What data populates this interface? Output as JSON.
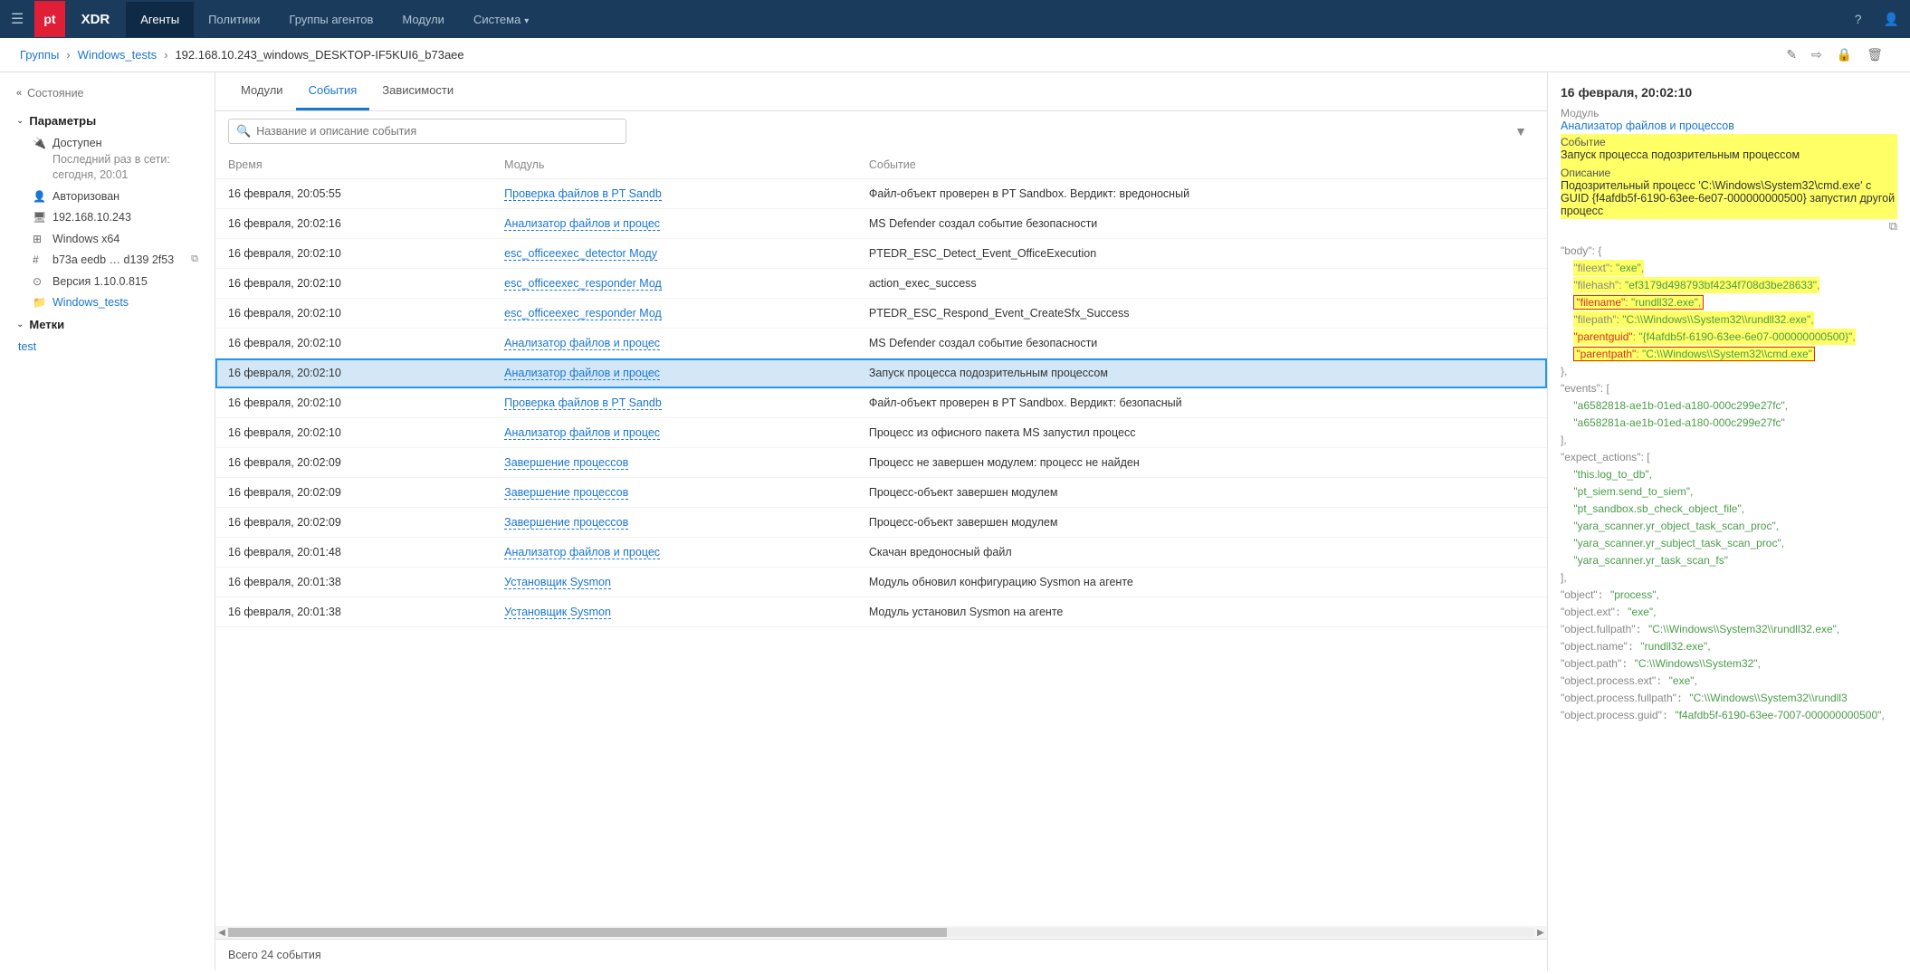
{
  "topbar": {
    "logo": "pt",
    "product": "XDR",
    "nav": [
      "Агенты",
      "Политики",
      "Группы агентов",
      "Модули",
      "Система"
    ],
    "nav_with_chevron": [
      false,
      false,
      false,
      false,
      true
    ]
  },
  "breadcrumb": {
    "groups": "Группы",
    "windows_tests": "Windows_tests",
    "current": "192.168.10.243_windows_DESKTOP-IF5KUI6_b73aee"
  },
  "sidebar": {
    "state_label": "Состояние",
    "params_label": "Параметры",
    "available": "Доступен",
    "last_seen_label": "Последний раз в сети: сегодня, 20:01",
    "authorized": "Авторизован",
    "ip": "192.168.10.243",
    "os": "Windows x64",
    "guid": "b73a eedb … d139 2f53",
    "version": "Версия 1.10.0.815",
    "group_link": "Windows_tests",
    "tags_label": "Метки",
    "tag": "test"
  },
  "tabs": {
    "modules": "Модули",
    "events": "События",
    "deps": "Зависимости"
  },
  "search": {
    "placeholder": "Название и описание события"
  },
  "table": {
    "cols": {
      "time": "Время",
      "module": "Модуль",
      "event": "Событие"
    },
    "rows": [
      {
        "time": "16 февраля, 20:05:55",
        "module": "Проверка файлов в PT Sandb",
        "event": "Файл-объект проверен в PT Sandbox. Вердикт: вредоносный"
      },
      {
        "time": "16 февраля, 20:02:16",
        "module": "Анализатор файлов и процес",
        "event": "MS Defender создал событие безопасности"
      },
      {
        "time": "16 февраля, 20:02:10",
        "module": "esc_officeexec_detector Моду",
        "event": "PTEDR_ESC_Detect_Event_OfficeExecution"
      },
      {
        "time": "16 февраля, 20:02:10",
        "module": "esc_officeexec_responder Мод",
        "event": "action_exec_success"
      },
      {
        "time": "16 февраля, 20:02:10",
        "module": "esc_officeexec_responder Мод",
        "event": "PTEDR_ESC_Respond_Event_CreateSfx_Success"
      },
      {
        "time": "16 февраля, 20:02:10",
        "module": "Анализатор файлов и процес",
        "event": "MS Defender создал событие безопасности"
      },
      {
        "time": "16 февраля, 20:02:10",
        "module": "Анализатор файлов и процес",
        "event": "Запуск процесса подозрительным процессом",
        "sel": true
      },
      {
        "time": "16 февраля, 20:02:10",
        "module": "Проверка файлов в PT Sandb",
        "event": "Файл-объект проверен в PT Sandbox. Вердикт: безопасный"
      },
      {
        "time": "16 февраля, 20:02:10",
        "module": "Анализатор файлов и процес",
        "event": "Процесс из офисного пакета MS запустил процесс"
      },
      {
        "time": "16 февраля, 20:02:09",
        "module": "Завершение процессов",
        "event": "Процесс не завершен модулем: процесс не найден"
      },
      {
        "time": "16 февраля, 20:02:09",
        "module": "Завершение процессов",
        "event": "Процесс-объект завершен модулем"
      },
      {
        "time": "16 февраля, 20:02:09",
        "module": "Завершение процессов",
        "event": "Процесс-объект завершен модулем"
      },
      {
        "time": "16 февраля, 20:01:48",
        "module": "Анализатор файлов и процес",
        "event": "Скачан вредоносный файл"
      },
      {
        "time": "16 февраля, 20:01:38",
        "module": "Установщик Sysmon",
        "event": "Модуль обновил конфигурацию Sysmon на агенте"
      },
      {
        "time": "16 февраля, 20:01:38",
        "module": "Установщик Sysmon",
        "event": "Модуль установил Sysmon на агенте"
      }
    ],
    "footer": "Всего 24 события"
  },
  "detail": {
    "title": "16 февраля, 20:02:10",
    "module_label": "Модуль",
    "module_link": "Анализатор файлов и процессов",
    "event_label": "Событие",
    "event_value": "Запуск процесса подозрительным процессом",
    "desc_label": "Описание",
    "desc_value": "Подозрительный процесс 'C:\\Windows\\System32\\cmd.exe' с GUID {f4afdb5f-6190-63ee-6e07-000000000500} запустил другой процесс",
    "json": {
      "body_open": "\"body\": {",
      "fileext": {
        "k": "\"fileext\"",
        "v": "\"exe\""
      },
      "filehash": {
        "k": "\"filehash\"",
        "v": "\"ef3179d498793bf4234f708d3be28633\""
      },
      "filename": {
        "k": "\"filename\"",
        "v": "\"rundll32.exe\""
      },
      "filepath": {
        "k": "\"filepath\"",
        "v": "\"C:\\\\Windows\\\\System32\\\\rundll32.exe\""
      },
      "parentguid": {
        "k": "\"parentguid\"",
        "v": "\"{f4afdb5f-6190-63ee-6e07-000000000500}\""
      },
      "parentpath": {
        "k": "\"parentpath\"",
        "v": "\"C:\\\\Windows\\\\System32\\\\cmd.exe\""
      },
      "body_close": "},",
      "events_open": "\"events\": [",
      "event1": "\"a6582818-ae1b-01ed-a180-000c299e27fc\",",
      "event2": "\"a658281a-ae1b-01ed-a180-000c299e27fc\"",
      "events_close": "],",
      "expect_open": "\"expect_actions\": [",
      "ea1": "\"this.log_to_db\",",
      "ea2": "\"pt_siem.send_to_siem\",",
      "ea3": "\"pt_sandbox.sb_check_object_file\",",
      "ea4": "\"yara_scanner.yr_object_task_scan_proc\",",
      "ea5": "\"yara_scanner.yr_subject_task_scan_proc\",",
      "ea6": "\"yara_scanner.yr_task_scan_fs\"",
      "expect_close": "],",
      "object": {
        "k": "\"object\"",
        "v": "\"process\","
      },
      "object_ext": {
        "k": "\"object.ext\"",
        "v": "\"exe\","
      },
      "object_fullpath": {
        "k": "\"object.fullpath\"",
        "v": "\"C:\\\\Windows\\\\System32\\\\rundll32.exe\","
      },
      "object_name": {
        "k": "\"object.name\"",
        "v": "\"rundll32.exe\","
      },
      "object_path": {
        "k": "\"object.path\"",
        "v": "\"C:\\\\Windows\\\\System32\","
      },
      "object_proc_ext": {
        "k": "\"object.process.ext\"",
        "v": "\"exe\","
      },
      "object_proc_fullpath": {
        "k": "\"object.process.fullpath\"",
        "v": "\"C:\\\\Windows\\\\System32\\\\rundll3"
      },
      "object_proc_guid": {
        "k": "\"object.process.guid\"",
        "v": "\"f4afdb5f-6190-63ee-7007-000000000500\","
      }
    }
  }
}
